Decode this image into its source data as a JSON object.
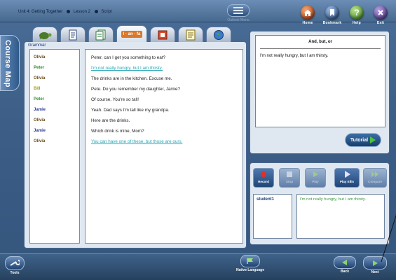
{
  "breadcrumb": {
    "unit": "Unit 4: Getting Together",
    "lesson": "Lesson 2",
    "section": "Script"
  },
  "top_nav": {
    "outlook_menu": "Outlook Menu",
    "home": "Home",
    "bookmark": "Bookmark",
    "help": "Help",
    "exit": "Exit"
  },
  "side_tab": {
    "label": "Course Map"
  },
  "tabs": [
    {
      "icon": "turtle-icon",
      "label": ""
    },
    {
      "icon": "document-icon",
      "label": ""
    },
    {
      "icon": "pages-icon",
      "label": ""
    },
    {
      "icon": "pronunciation-icon",
      "label": "l · an · fa"
    },
    {
      "icon": "book-icon",
      "label": ""
    },
    {
      "icon": "notes-icon",
      "label": ""
    },
    {
      "icon": "globe-icon",
      "label": ""
    }
  ],
  "grammar_label": "Grammar",
  "dialog": [
    {
      "speaker": "Olivia",
      "speaker_color": "#6a4a1a",
      "text": "Peter, can I get you something to eat?",
      "link": false
    },
    {
      "speaker": "Peter",
      "speaker_color": "#2f8a2f",
      "text": "I'm not really hungry, but I am thirsty.",
      "link": true
    },
    {
      "speaker": "Olivia",
      "speaker_color": "#6a4a1a",
      "text": "The drinks are in the kitchen.  Excuse me.",
      "link": false
    },
    {
      "speaker": "Bill",
      "speaker_color": "#9a9a20",
      "text": "Pete.  Do you remember my daughter, Jamie?",
      "link": false
    },
    {
      "speaker": "Peter",
      "speaker_color": "#2f8a2f",
      "text": "Of course.  You're so tall!",
      "link": false
    },
    {
      "speaker": "Jamie",
      "speaker_color": "#2a3a9a",
      "text": "Yeah.  Dad says I'm tall like my grandpa.",
      "link": false
    },
    {
      "speaker": "Olivia",
      "speaker_color": "#6a4a1a",
      "text": "Here are the drinks.",
      "link": false
    },
    {
      "speaker": "Jamie",
      "speaker_color": "#2a3a9a",
      "text": "Which drink is mine, Mom?",
      "link": false
    },
    {
      "speaker": "Olivia",
      "speaker_color": "#6a4a1a",
      "text": "You can have one of these, but those are ours.",
      "link": true
    }
  ],
  "note": {
    "title": "And, but, or",
    "text": "I'm not really hungry, but I am thirsty."
  },
  "tutorial_button": "Tutorial",
  "record_controls": [
    {
      "label": "Record",
      "icon": "record-icon",
      "active": true
    },
    {
      "label": "Stop",
      "icon": "stop-icon",
      "active": false
    },
    {
      "label": "Play",
      "icon": "play-icon",
      "active": false
    },
    {
      "label": "Play Ellis",
      "icon": "play-ellis-icon",
      "active": true
    },
    {
      "label": "Compare",
      "icon": "compare-icon",
      "active": false
    }
  ],
  "student_label": "student1",
  "transcript": "I'm not really hungry, but I am thirsty.",
  "bottom": {
    "tools": "Tools",
    "native_language": "Native Language",
    "back": "Back",
    "next": "Next"
  }
}
